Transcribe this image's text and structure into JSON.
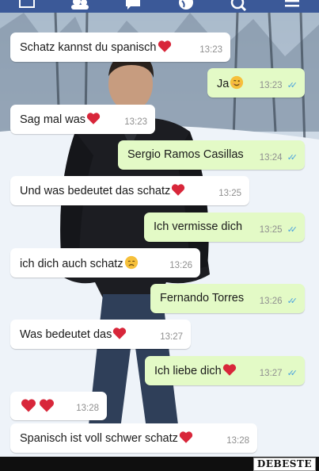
{
  "nav": {
    "icons": [
      "home-icon",
      "friends-icon",
      "messages-icon",
      "globe-icon",
      "search-icon",
      "menu-icon"
    ]
  },
  "messages": [
    {
      "dir": "in",
      "text": "Schatz kannst du spanisch",
      "emoji": "heart",
      "time": "13:23"
    },
    {
      "dir": "out",
      "text": "Ja",
      "emoji": "smile",
      "time": "13:23",
      "read": true
    },
    {
      "dir": "in",
      "text": "Sag mal was",
      "emoji": "heart",
      "time": "13:23"
    },
    {
      "dir": "out",
      "text": "Sergio Ramos Casillas",
      "time": "13:24",
      "read": true
    },
    {
      "dir": "in",
      "text": "Und was bedeutet das schatz",
      "emoji": "heart",
      "time": "13:25"
    },
    {
      "dir": "out",
      "text": "Ich vermisse dich",
      "time": "13:25",
      "read": true
    },
    {
      "dir": "in",
      "text": "ich dich auch schatz",
      "emoji": "sad",
      "time": "13:26"
    },
    {
      "dir": "out",
      "text": "Fernando Torres",
      "time": "13:26",
      "read": true
    },
    {
      "dir": "in",
      "text": "Was bedeutet das",
      "emoji": "heart",
      "time": "13:27"
    },
    {
      "dir": "out",
      "text": "Ich liebe dich",
      "emoji": "heart",
      "time": "13:27",
      "read": true
    },
    {
      "dir": "in",
      "text": "",
      "emoji": "two-hearts",
      "time": "13:28"
    },
    {
      "dir": "in",
      "text": "Spanisch ist voll schwer schatz",
      "emoji": "heart",
      "time": "13:28"
    }
  ],
  "watermark": "DEBESTE",
  "colors": {
    "incoming_bubble": "#ffffff",
    "outgoing_bubble": "#e3fac6",
    "read_ticks": "#4aa3df",
    "heart": "#d8263a",
    "nav_bar": "#3b5998"
  }
}
